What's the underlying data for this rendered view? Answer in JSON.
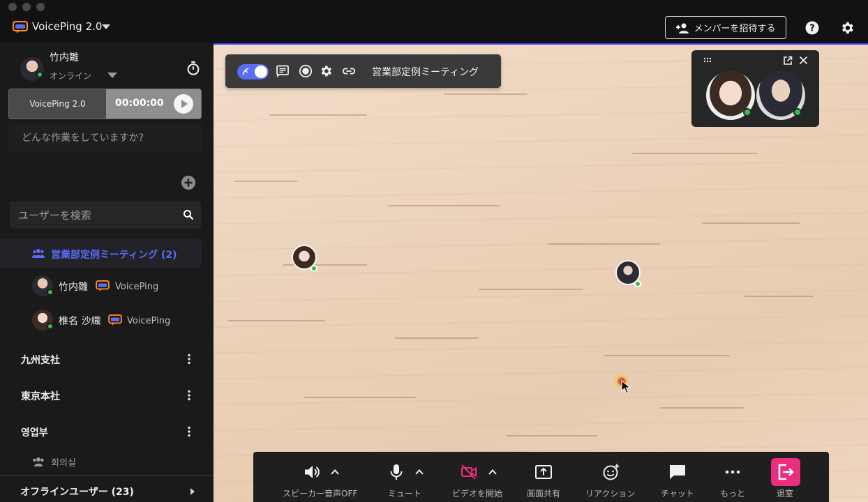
{
  "app": {
    "name": "VoicePing 2.0",
    "invite_label": "メンバーを招待する",
    "help_icon": "help-circle-icon",
    "settings_icon": "gear-icon"
  },
  "user": {
    "name": "竹内雛",
    "status": "オンライン"
  },
  "timer": {
    "app_label": "VoicePing 2.0",
    "time": "00:00:00"
  },
  "task": {
    "placeholder": "どんな作業をしていますか?"
  },
  "search": {
    "placeholder": "ユーザーを検索"
  },
  "active_room": {
    "label": "営業部定例ミーティング (2)",
    "members": [
      {
        "name": "竹内雛",
        "app": "VoicePing"
      },
      {
        "name": "椎名 沙織",
        "app": "VoicePing"
      }
    ]
  },
  "groups": [
    {
      "label": "九州支社"
    },
    {
      "label": "東京本社"
    },
    {
      "label": "영업부"
    }
  ],
  "sub_room": {
    "label": "회의실"
  },
  "offline": {
    "label": "オフラインユーザー (23)"
  },
  "meeting": {
    "title": "営業部定例ミーティング"
  },
  "controls": {
    "speaker": "スピーカー音声OFF",
    "mute": "ミュート",
    "video": "ビデオを開始",
    "share": "画面共有",
    "reaction": "リアクション",
    "chat": "チャット",
    "more": "もっと",
    "leave": "退室"
  },
  "colors": {
    "accent": "#5b6cf5",
    "online": "#2fbd4a",
    "leave": "#ea2d7e",
    "video_off": "#ea2d7e"
  }
}
